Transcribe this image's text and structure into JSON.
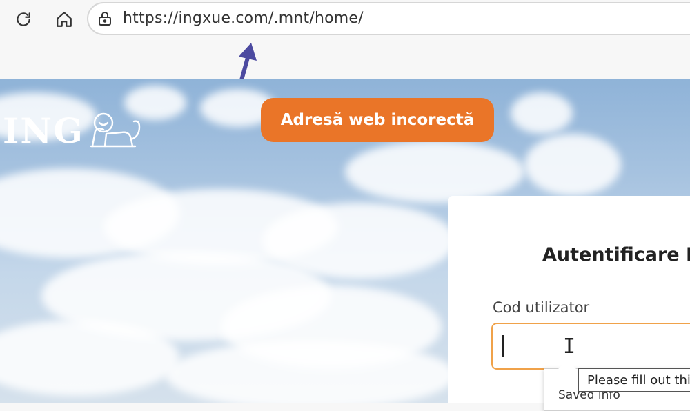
{
  "browser": {
    "url": "https://ingxue.com/.mnt/home/",
    "reload_icon": "reload-icon",
    "home_icon": "home-icon",
    "site_info_icon": "site-info-icon"
  },
  "annotation": {
    "label": "Adresă web incorectă",
    "color": "#ea7528",
    "arrow_color": "#4c4aa0"
  },
  "page": {
    "logo_text": "ING",
    "login": {
      "title": "Autentificare ING",
      "field_label": "Cod utilizator",
      "field_value": "",
      "validation_tooltip": "Please fill out this",
      "autocomplete_label": "Saved info"
    }
  }
}
